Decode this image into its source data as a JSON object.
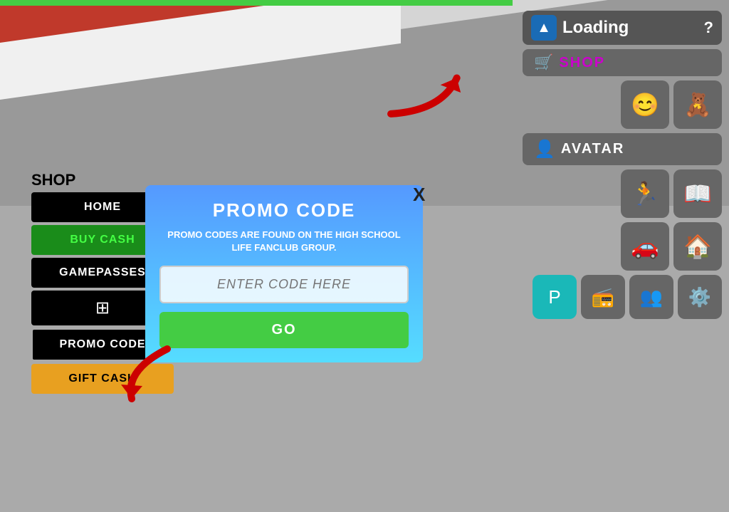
{
  "background": {
    "floor_color": "#aaaaaa",
    "stripe_color": "#c0392b"
  },
  "top_bar": {
    "color": "#44cc44"
  },
  "loading": {
    "icon": "▲",
    "label": "Loading",
    "question": "?",
    "icon_bg": "#1a6bb5"
  },
  "shop_top_button": {
    "label": "SHOP",
    "cart_icon": "🛒"
  },
  "icon_buttons_row1": {
    "smiley": "😊",
    "teddy": "🧸"
  },
  "avatar_button": {
    "icon": "👤",
    "label": "AVATAR"
  },
  "icon_buttons_row2": {
    "run": "🏃",
    "book": "📖"
  },
  "icon_buttons_row3": {
    "car": "🚗",
    "home": "🏠"
  },
  "icon_buttons_row4": {
    "parking": "P",
    "radio": "📻",
    "people": "👥",
    "gear": "⚙️"
  },
  "shop_panel": {
    "title": "SHOP",
    "close_label": "X",
    "menu": [
      {
        "label": "HOME",
        "style": "black"
      },
      {
        "label": "BUY CASH",
        "style": "green"
      },
      {
        "label": "GAMEPASSES",
        "style": "black"
      },
      {
        "label": "⊞",
        "style": "icon"
      },
      {
        "label": "PROMO CODE",
        "style": "black"
      },
      {
        "label": "GIFT CASH",
        "style": "orange"
      }
    ]
  },
  "promo_dialog": {
    "title": "PROMO CODE",
    "description": "PROMO CODES ARE FOUND ON THE HIGH SCHOOL LIFE FANCLUB GROUP.",
    "input_placeholder": "ENTER CODE HERE",
    "go_button": "GO"
  },
  "arrows": {
    "top_arrow": "↗",
    "bottom_arrow": "↙"
  }
}
